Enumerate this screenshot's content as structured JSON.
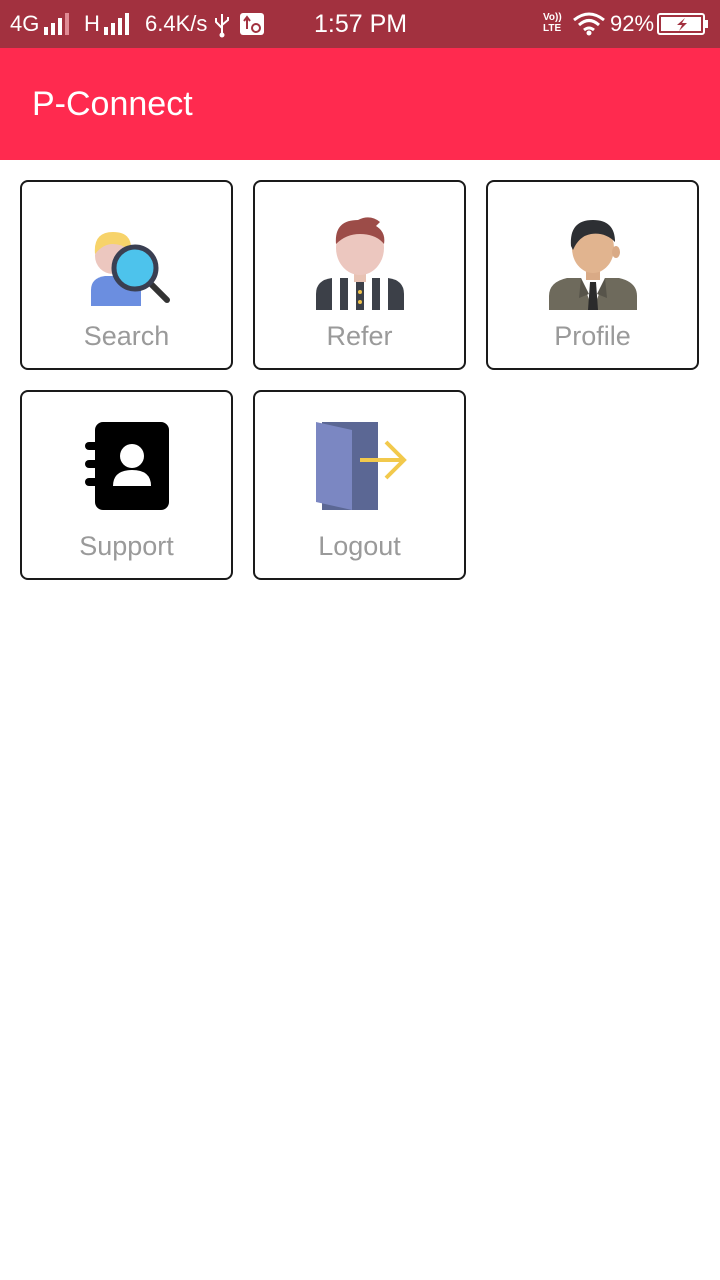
{
  "status_bar": {
    "network_4g": "4G",
    "network_h": "H",
    "speed": "6.4K/s",
    "time": "1:57 PM",
    "volte": "Vo)) LTE",
    "battery": "92%"
  },
  "app_bar": {
    "title": "P-Connect"
  },
  "tiles": [
    {
      "label": "Search",
      "icon": "search-user-icon"
    },
    {
      "label": "Refer",
      "icon": "referee-icon"
    },
    {
      "label": "Profile",
      "icon": "businessman-icon"
    },
    {
      "label": "Support",
      "icon": "contact-book-icon"
    },
    {
      "label": "Logout",
      "icon": "logout-door-icon"
    }
  ],
  "colors": {
    "status_bar": "#a2313f",
    "app_bar": "#ff2a4f",
    "tile_border": "#1a1a1a",
    "tile_label": "#9a9a9a"
  }
}
